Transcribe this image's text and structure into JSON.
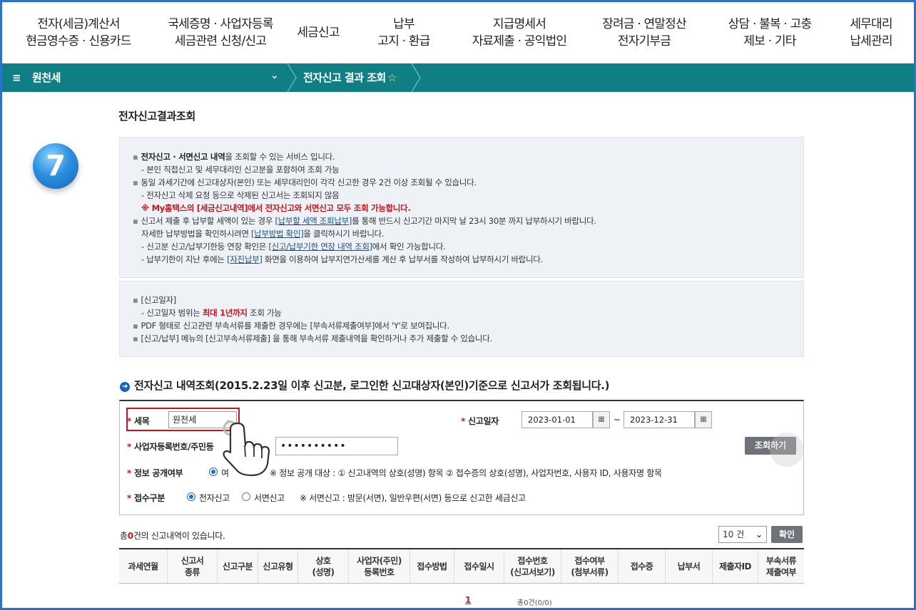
{
  "nav": {
    "menus": [
      {
        "l1": "전자(세금)계산서",
        "l2": "현금영수증 · 신용카드"
      },
      {
        "l1": "국세증명 · 사업자등록",
        "l2": "세금관련 신청/신고"
      },
      {
        "l1": "세금신고",
        "l2": ""
      },
      {
        "l1": "납부",
        "l2": "고지 · 환급"
      },
      {
        "l1": "지급명세서",
        "l2": "자료제출 · 공익법인"
      },
      {
        "l1": "장려금 · 연말정산",
        "l2": "전자기부금"
      },
      {
        "l1": "상담 · 불복 · 고충",
        "l2": "제보 · 기타"
      },
      {
        "l1": "세무대리",
        "l2": "납세관리"
      }
    ]
  },
  "greenbar": {
    "menu_icon": "≡",
    "section": "원천세",
    "chevron": "⌄",
    "crumb": "전자신고 결과 조회",
    "star": "☆"
  },
  "page": {
    "title": "전자신고결과조회",
    "step_badge": "7"
  },
  "info1": {
    "l1_bold": "전자신고 · 서면신고 내역",
    "l1_rest": "을 조회할 수 있는 서비스 입니다.",
    "l2": "- 본인 직접신고 및 세무대리인 신고분을 포함하여 조회 가능",
    "l3": "동일 과세기간에 신고대상자(본인) 또는 세무대리인이 각각 신고한 경우 2건 이상 조회될 수 있습니다.",
    "l4": "- 전자신고 삭제 요청 등으로 삭제된 신고서는 조회되지 않음",
    "l5": "※ My홈택스의 [세금신고내역]에서 전자신고와 서면신고 모두 조회 가능합니다.",
    "l6_a": "신고서 제출 후 납부할 세액이 있는 경우 ",
    "l6_link": "[납부할 세액 조회납부]",
    "l6_b": "를 통해 반드시 신고기간 마지막 날 23시 30분 까지 납부하시기 바랍니다.",
    "l7_a": "자세한 납부방법을 확인하시려면 ",
    "l7_link": "[납부방법 확인]",
    "l7_b": "을 클릭하시기 바랍니다.",
    "l8_a": "- 신고분 신고/납부기한등 연장 확인은 ",
    "l8_link": "[신고/납부기한 연장 내역 조회]",
    "l8_b": "에서 확인 가능합니다.",
    "l9_a": "- 납부기한이 지난 후에는 ",
    "l9_link": "[자진납부]",
    "l9_b": " 화면을 이용하여 납부지연가산세를 계산 후 납부서를 작성하여 납부하시기 바랍니다."
  },
  "info2": {
    "l1": "[신고일자]",
    "l2_a": "- 신고일자 범위는 ",
    "l2_red": "최대 1년까지",
    "l2_b": " 조회 가능",
    "l3": "PDF 형태로 신고관련 부속서류를 제출한 경우에는 [부속서류제출여부]에서 'Y'로 보여집니다.",
    "l4": "[신고/납부] 메뉴의 [신고부속서류제출] 을 통해 부속서류 제출내역을 확인하거나 추가 제출할 수 있습니다."
  },
  "section": {
    "icon": "➜",
    "title": "전자신고 내역조회(2015.2.23일 이후 신고분, 로그인한  신고대상자(본인)기준으로  신고서가 조회됩니다.)"
  },
  "form": {
    "req_mark": "*",
    "tax_label": "세목",
    "tax_value": "원천세",
    "date_label": "신고일자",
    "date_from": "2023-01-01",
    "date_to": "2023-12-31",
    "cal_icon": "▦",
    "tilde": "~",
    "biz_label": "사업자등록번호/주민등",
    "biz_value": "••••••••••",
    "search_btn": "조회하기",
    "public_label": "정보 공개여부",
    "public_yes": "여",
    "public_note": "※ 정보 공개 대상 : ① 신고내역의 상호(성명) 항목 ② 접수증의 상호(성명), 사업자번호, 사용자 ID, 사용자명 항목",
    "recv_label": "접수구분",
    "recv_e": "전자신고",
    "recv_p": "서면신고",
    "recv_note": "※ 서면신고 : 방문(서면), 일반우편(서면) 등으로 신고한 세금신고"
  },
  "result": {
    "count_a": "총",
    "count_n": "0",
    "count_b": "건의 신고내역이 있습니다.",
    "page_size": "10 건",
    "confirm_btn": "확인",
    "columns": [
      "과세연월",
      "신고서\n종류",
      "신고구분",
      "신고유형",
      "상호\n(성명)",
      "사업자(주민)\n등록번호",
      "접수방법",
      "접수일시",
      "접수번호\n(신고서보기)",
      "접수여부\n(첨부서류)",
      "접수증",
      "납부서",
      "제출자ID",
      "부속서류\n제출여부"
    ],
    "page_num": "1",
    "total": "총0건(0/0)"
  },
  "colors": {
    "accent": "#0f7f85",
    "red": "#c4161c",
    "frame": "#2a73c9"
  }
}
